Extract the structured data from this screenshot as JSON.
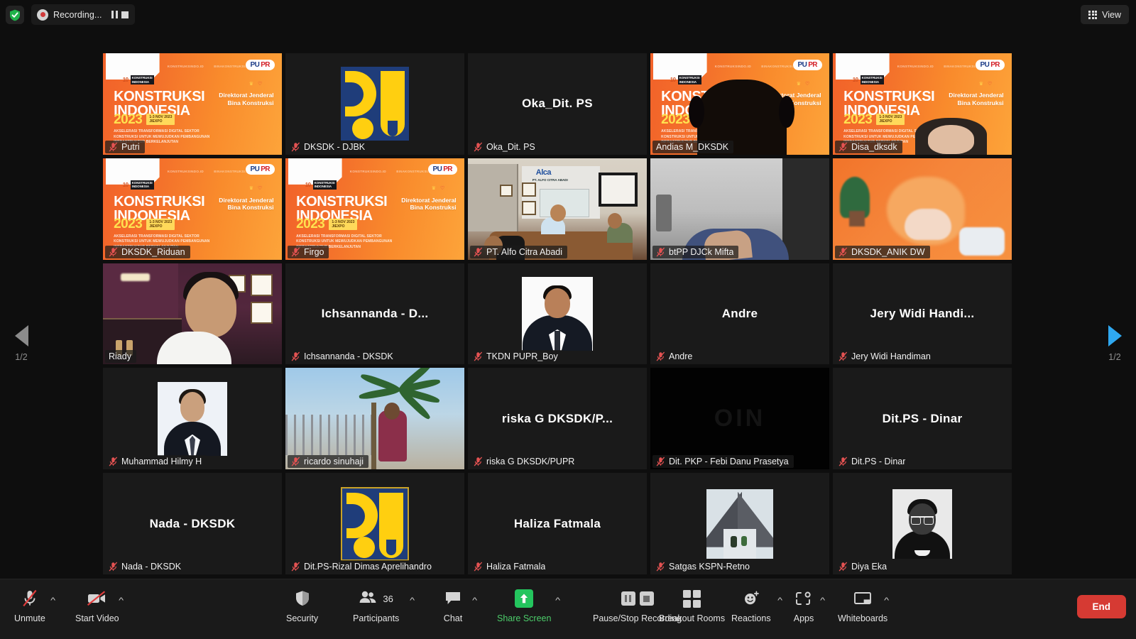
{
  "topbar": {
    "shield_icon": "shield-check-icon",
    "recording": {
      "label": "Recording...",
      "pause_icon": "pause-icon",
      "stop_icon": "stop-icon"
    },
    "view": {
      "label": "View",
      "icon": "grid-icon"
    }
  },
  "gallery": {
    "pager_left": {
      "icon": "chevron-left-icon",
      "page": "1/2"
    },
    "pager_right": {
      "icon": "chevron-right-icon",
      "page": "1/2"
    },
    "mic_off_icon": "microphone-off-icon",
    "banner": {
      "title_line1": "KONSTRUKSI",
      "title_line2": "INDONESIA",
      "year": "2023",
      "date": "1-3 NOV 2023\nJIEXPO",
      "subtitle": "AKSELERASI TRANSFORMASI DIGITAL SEKTOR KONSTRUKSI UNTUK MEWUJUDKAN PEMBANGUNAN INFRASTRUKTUR BERKELANJUTAN",
      "org_line1": "Direktorat Jenderal",
      "org_line2": "Bina Konstruksi",
      "url1": "KONSTRUKSINDO.ID",
      "url2": "BINAKONSTRUKSI.PU.GO.ID",
      "pupr_left": "PU",
      "pupr_right": "PR",
      "logo_number": "10",
      "logo_text": "KONSTRUKSI INDONESIA"
    },
    "tiles": [
      {
        "name": "Putri",
        "muted": true,
        "kind": "banner",
        "big_name": ""
      },
      {
        "name": "DKSDK - DJBK",
        "muted": true,
        "kind": "pu-logo",
        "big_name": ""
      },
      {
        "name": "Oka_Dit. PS",
        "muted": true,
        "kind": "name-only",
        "big_name": "Oka_Dit. PS"
      },
      {
        "name": "Andias M_DKSDK",
        "muted": false,
        "kind": "banner-person",
        "big_name": "",
        "active_speaker": true
      },
      {
        "name": "Disa_dksdk",
        "muted": true,
        "kind": "banner-person2",
        "big_name": ""
      },
      {
        "name": "DKSDK_Riduan",
        "muted": true,
        "kind": "banner",
        "big_name": ""
      },
      {
        "name": "Firgo",
        "muted": true,
        "kind": "banner",
        "big_name": ""
      },
      {
        "name": "PT. Alfo Citra Abadi",
        "muted": true,
        "kind": "alfo",
        "big_name": ""
      },
      {
        "name": "btPP DJCk Mifta",
        "muted": true,
        "kind": "btpp",
        "big_name": ""
      },
      {
        "name": "DKSDK_ANIK DW",
        "muted": true,
        "kind": "anik",
        "big_name": ""
      },
      {
        "name": "Riady",
        "muted": false,
        "kind": "riady",
        "big_name": ""
      },
      {
        "name": "Ichsannanda - DKSDK",
        "muted": true,
        "kind": "name-only",
        "big_name": "Ichsannanda - D..."
      },
      {
        "name": "TKDN PUPR_Boy",
        "muted": true,
        "kind": "tkdn-photo",
        "big_name": ""
      },
      {
        "name": "Andre",
        "muted": true,
        "kind": "name-only",
        "big_name": "Andre"
      },
      {
        "name": "Jery Widi Handiman",
        "muted": true,
        "kind": "name-only",
        "big_name": "Jery Widi Handi..."
      },
      {
        "name": "Muhammad Hilmy H",
        "muted": true,
        "kind": "portrait-a",
        "big_name": ""
      },
      {
        "name": "ricardo sinuhaji",
        "muted": true,
        "kind": "ricardo",
        "big_name": ""
      },
      {
        "name": "riska G DKSDK/PUPR",
        "muted": true,
        "kind": "name-only",
        "big_name": "riska G DKSDK/P..."
      },
      {
        "name": "Dit. PKP - Febi Danu Prasetya",
        "muted": true,
        "kind": "febi",
        "big_name": ""
      },
      {
        "name": "Dit.PS - Dinar",
        "muted": true,
        "kind": "name-only",
        "big_name": "Dit.PS - Dinar"
      },
      {
        "name": "Nada - DKSDK",
        "muted": true,
        "kind": "name-only",
        "big_name": "Nada - DKSDK"
      },
      {
        "name": "Dit.PS-Rizal Dimas Aprelihandro",
        "muted": true,
        "kind": "pu-logo-framed",
        "big_name": ""
      },
      {
        "name": "Haliza Fatmala",
        "muted": true,
        "kind": "name-only",
        "big_name": "Haliza Fatmala"
      },
      {
        "name": "Satgas KSPN-Retno",
        "muted": true,
        "kind": "satgas",
        "big_name": ""
      },
      {
        "name": "Diya Eka",
        "muted": true,
        "kind": "portrait-bw",
        "big_name": ""
      }
    ]
  },
  "toolbar": {
    "mute": {
      "label": "Unmute",
      "icon": "microphone-off-icon",
      "caret": "chevron-up-icon"
    },
    "video": {
      "label": "Start Video",
      "icon": "video-off-icon",
      "caret": "chevron-up-icon"
    },
    "security": {
      "label": "Security",
      "icon": "shield-icon"
    },
    "participants": {
      "label": "Participants",
      "count": "36",
      "icon": "people-icon",
      "caret": "chevron-up-icon"
    },
    "chat": {
      "label": "Chat",
      "icon": "chat-bubble-icon",
      "caret": "chevron-up-icon"
    },
    "share": {
      "label": "Share Screen",
      "icon": "share-arrow-up-icon",
      "caret": "chevron-up-icon"
    },
    "recording": {
      "label": "Pause/Stop Recording",
      "pause_icon": "pause-icon",
      "stop_icon": "stop-icon"
    },
    "breakout": {
      "label": "Breakout Rooms",
      "icon": "grid-squares-icon"
    },
    "reactions": {
      "label": "Reactions",
      "icon": "smiley-plus-icon",
      "caret": "chevron-up-icon"
    },
    "apps": {
      "label": "Apps",
      "icon": "apps-icon",
      "caret": "chevron-up-icon"
    },
    "whiteboards": {
      "label": "Whiteboards",
      "icon": "whiteboard-icon",
      "caret": "chevron-up-icon"
    },
    "end": {
      "label": "End"
    }
  },
  "colors": {
    "accent_green": "#24c55e",
    "end_red": "#d63a33",
    "active_speaker": "#d8e043",
    "page_next_blue": "#2fa8f0",
    "banner_orange": "#f2622a"
  }
}
